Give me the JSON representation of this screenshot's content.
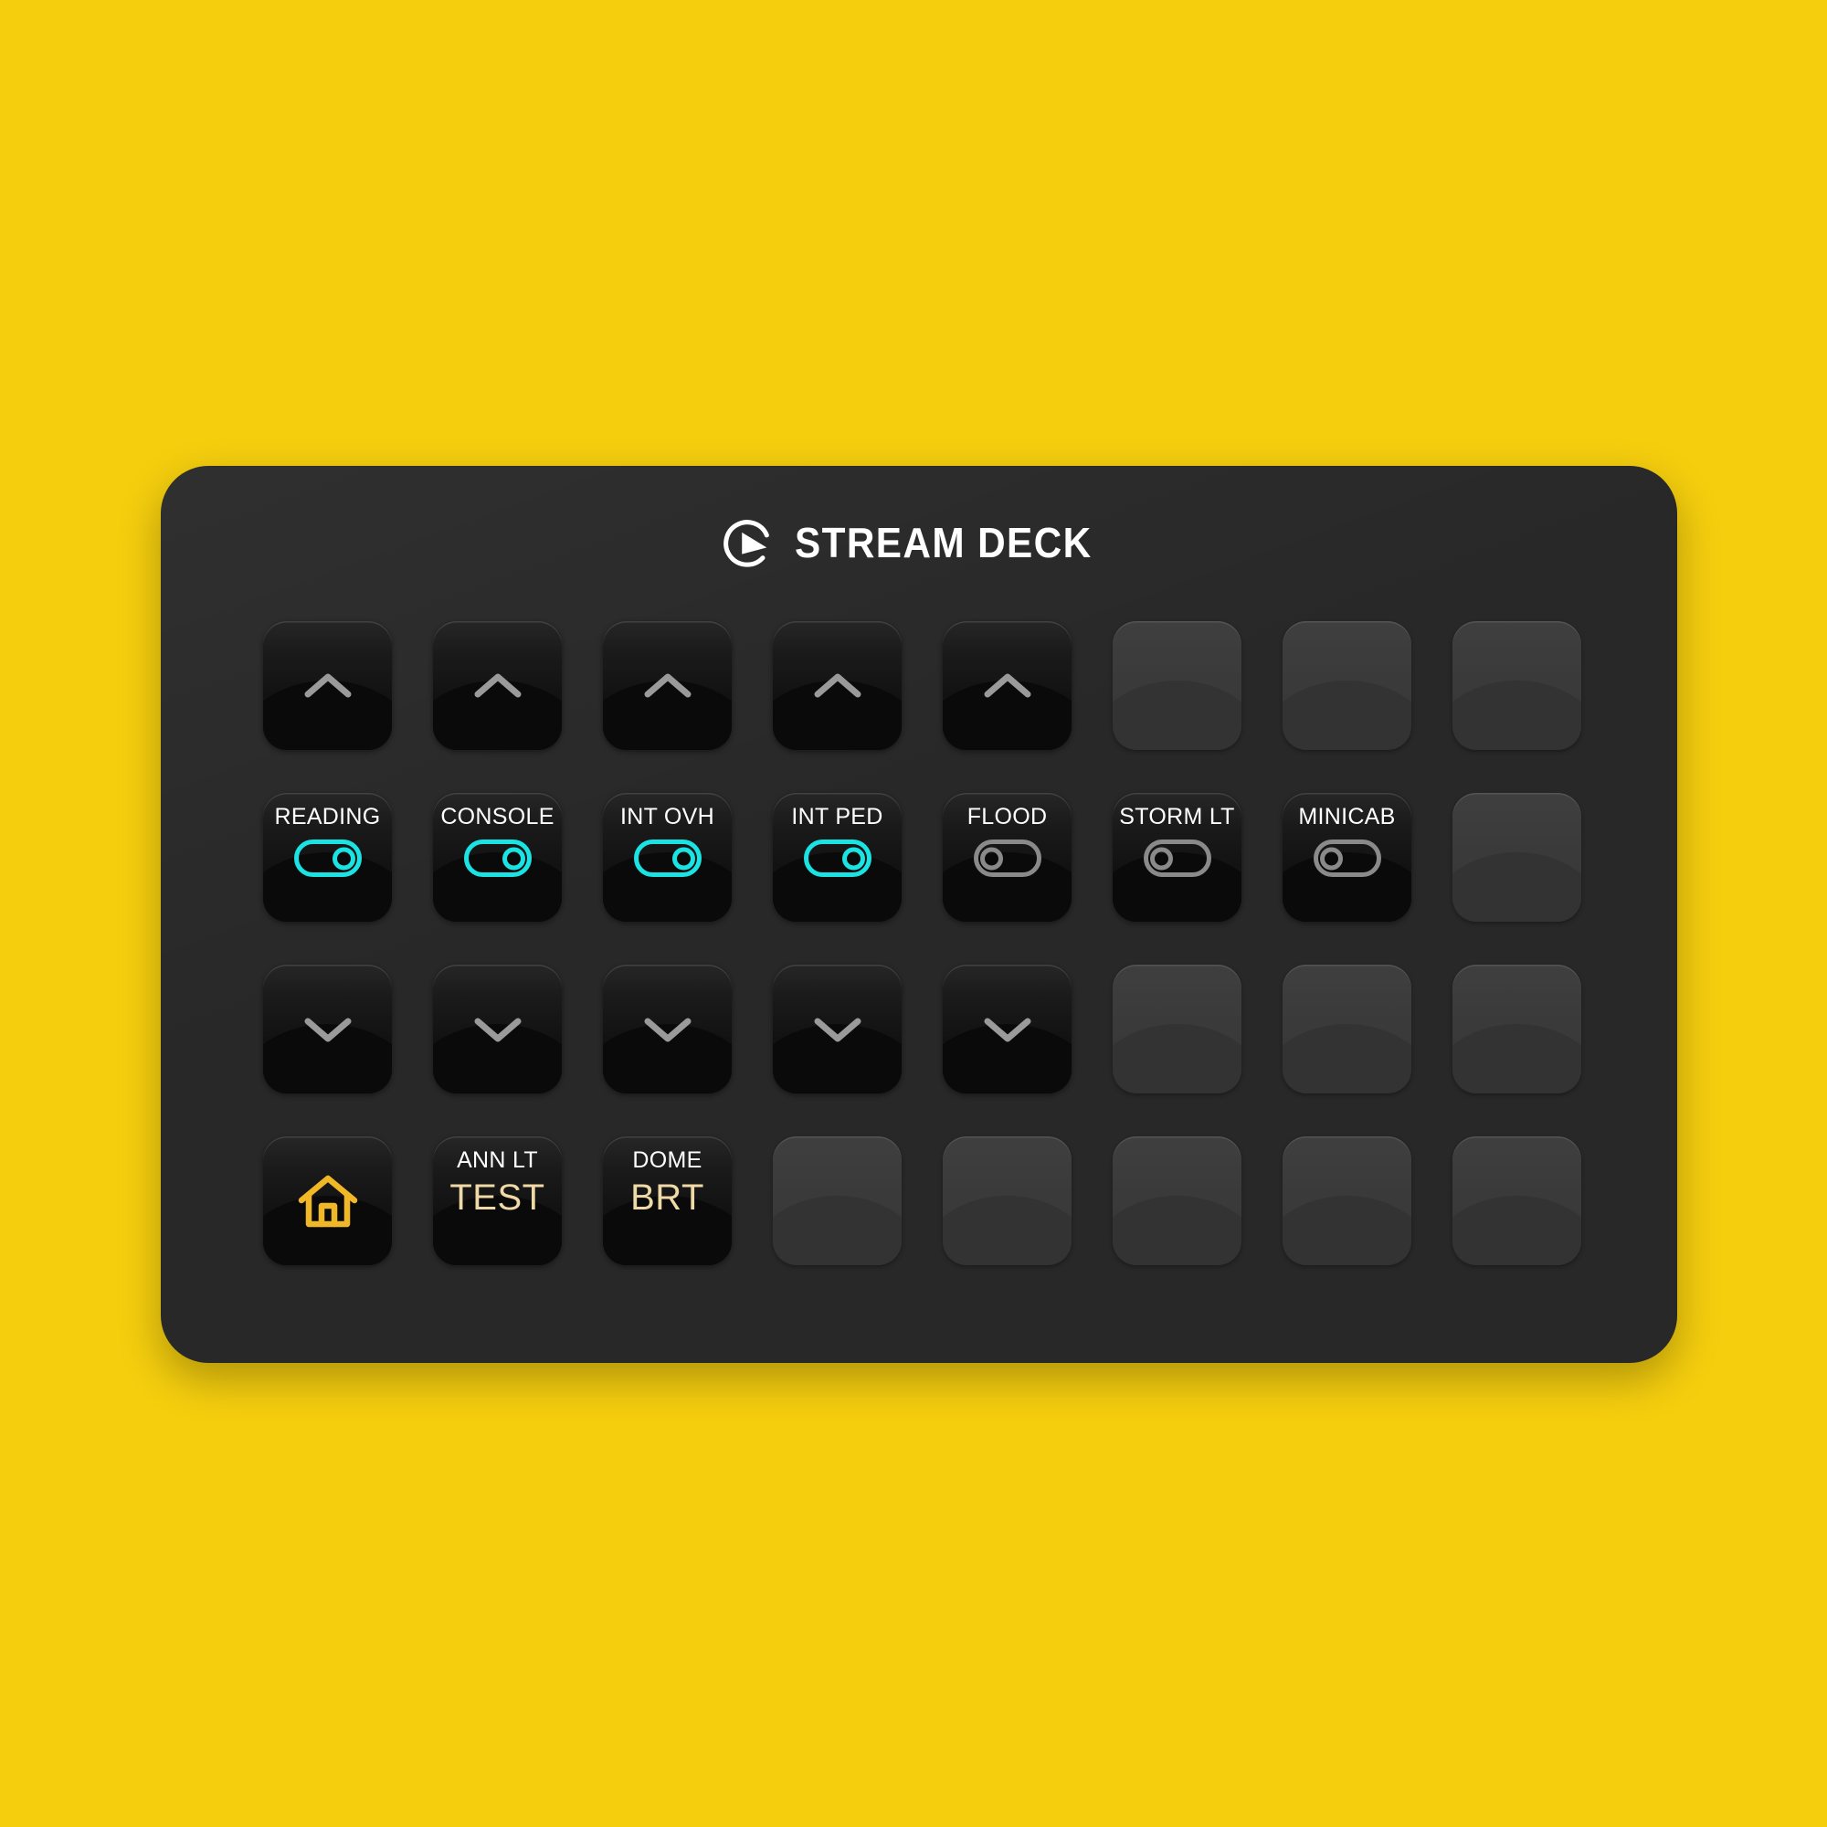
{
  "device": {
    "brand_name": "STREAM DECK",
    "logo_icon": "elgato-logo-icon",
    "body_color": "#282828",
    "background_color": "#F5CE0E"
  },
  "colors": {
    "toggle_on": "#1BE3E3",
    "toggle_off": "#8a8a8a",
    "home_icon": "#F0B826",
    "value_text": "#EFD9A6",
    "caption_text": "#FFFFFF",
    "chevron": "#9A9A9A"
  },
  "grid": {
    "columns": 8,
    "rows": 4,
    "keys": [
      {
        "row": 1,
        "col": 1,
        "state": "active",
        "type": "chevron-up",
        "icon": "chevron-up-icon",
        "caption": "",
        "value": ""
      },
      {
        "row": 1,
        "col": 2,
        "state": "active",
        "type": "chevron-up",
        "icon": "chevron-up-icon",
        "caption": "",
        "value": ""
      },
      {
        "row": 1,
        "col": 3,
        "state": "active",
        "type": "chevron-up",
        "icon": "chevron-up-icon",
        "caption": "",
        "value": ""
      },
      {
        "row": 1,
        "col": 4,
        "state": "active",
        "type": "chevron-up",
        "icon": "chevron-up-icon",
        "caption": "",
        "value": ""
      },
      {
        "row": 1,
        "col": 5,
        "state": "active",
        "type": "chevron-up",
        "icon": "chevron-up-icon",
        "caption": "",
        "value": ""
      },
      {
        "row": 1,
        "col": 6,
        "state": "blank",
        "type": "empty",
        "icon": "",
        "caption": "",
        "value": ""
      },
      {
        "row": 1,
        "col": 7,
        "state": "blank",
        "type": "empty",
        "icon": "",
        "caption": "",
        "value": ""
      },
      {
        "row": 1,
        "col": 8,
        "state": "blank",
        "type": "empty",
        "icon": "",
        "caption": "",
        "value": ""
      },
      {
        "row": 2,
        "col": 1,
        "state": "active",
        "type": "toggle",
        "icon": "toggle-on-icon",
        "caption": "READING",
        "toggle": "on"
      },
      {
        "row": 2,
        "col": 2,
        "state": "active",
        "type": "toggle",
        "icon": "toggle-on-icon",
        "caption": "CONSOLE",
        "toggle": "on"
      },
      {
        "row": 2,
        "col": 3,
        "state": "active",
        "type": "toggle",
        "icon": "toggle-on-icon",
        "caption": "INT OVH",
        "toggle": "on"
      },
      {
        "row": 2,
        "col": 4,
        "state": "active",
        "type": "toggle",
        "icon": "toggle-on-icon",
        "caption": "INT PED",
        "toggle": "on"
      },
      {
        "row": 2,
        "col": 5,
        "state": "active",
        "type": "toggle",
        "icon": "toggle-off-icon",
        "caption": "FLOOD",
        "toggle": "off"
      },
      {
        "row": 2,
        "col": 6,
        "state": "active",
        "type": "toggle",
        "icon": "toggle-off-icon",
        "caption": "STORM LT",
        "toggle": "off"
      },
      {
        "row": 2,
        "col": 7,
        "state": "active",
        "type": "toggle",
        "icon": "toggle-off-icon",
        "caption": "MINICAB",
        "toggle": "off"
      },
      {
        "row": 2,
        "col": 8,
        "state": "blank",
        "type": "empty",
        "icon": "",
        "caption": "",
        "value": ""
      },
      {
        "row": 3,
        "col": 1,
        "state": "active",
        "type": "chevron-down",
        "icon": "chevron-down-icon",
        "caption": "",
        "value": ""
      },
      {
        "row": 3,
        "col": 2,
        "state": "active",
        "type": "chevron-down",
        "icon": "chevron-down-icon",
        "caption": "",
        "value": ""
      },
      {
        "row": 3,
        "col": 3,
        "state": "active",
        "type": "chevron-down",
        "icon": "chevron-down-icon",
        "caption": "",
        "value": ""
      },
      {
        "row": 3,
        "col": 4,
        "state": "active",
        "type": "chevron-down",
        "icon": "chevron-down-icon",
        "caption": "",
        "value": ""
      },
      {
        "row": 3,
        "col": 5,
        "state": "active",
        "type": "chevron-down",
        "icon": "chevron-down-icon",
        "caption": "",
        "value": ""
      },
      {
        "row": 3,
        "col": 6,
        "state": "blank",
        "type": "empty",
        "icon": "",
        "caption": "",
        "value": ""
      },
      {
        "row": 3,
        "col": 7,
        "state": "blank",
        "type": "empty",
        "icon": "",
        "caption": "",
        "value": ""
      },
      {
        "row": 3,
        "col": 8,
        "state": "blank",
        "type": "empty",
        "icon": "",
        "caption": "",
        "value": ""
      },
      {
        "row": 4,
        "col": 1,
        "state": "active",
        "type": "home",
        "icon": "home-icon",
        "caption": "",
        "value": ""
      },
      {
        "row": 4,
        "col": 2,
        "state": "active",
        "type": "label",
        "icon": "",
        "caption": "ANN LT",
        "value": "TEST"
      },
      {
        "row": 4,
        "col": 3,
        "state": "active",
        "type": "label",
        "icon": "",
        "caption": "DOME",
        "value": "BRT"
      },
      {
        "row": 4,
        "col": 4,
        "state": "blank",
        "type": "empty",
        "icon": "",
        "caption": "",
        "value": ""
      },
      {
        "row": 4,
        "col": 5,
        "state": "blank",
        "type": "empty",
        "icon": "",
        "caption": "",
        "value": ""
      },
      {
        "row": 4,
        "col": 6,
        "state": "blank",
        "type": "empty",
        "icon": "",
        "caption": "",
        "value": ""
      },
      {
        "row": 4,
        "col": 7,
        "state": "blank",
        "type": "empty",
        "icon": "",
        "caption": "",
        "value": ""
      },
      {
        "row": 4,
        "col": 8,
        "state": "blank",
        "type": "empty",
        "icon": "",
        "caption": "",
        "value": ""
      }
    ]
  }
}
